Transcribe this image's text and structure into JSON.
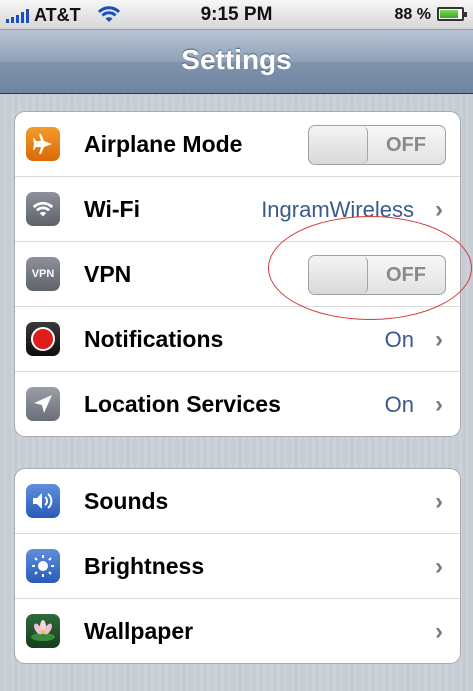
{
  "status_bar": {
    "carrier": "AT&T",
    "time": "9:15 PM",
    "battery": "88 %",
    "battery_level": 0.88
  },
  "nav": {
    "title": "Settings"
  },
  "group1": [
    {
      "label": "Airplane Mode",
      "icon": "airplane-icon",
      "control": "toggle",
      "state": "OFF"
    },
    {
      "label": "Wi-Fi",
      "icon": "wifi-icon",
      "value": "IngramWireless",
      "chevron": "›"
    },
    {
      "label": "VPN",
      "icon": "vpn-icon",
      "icon_text": "VPN",
      "control": "toggle",
      "state": "OFF"
    },
    {
      "label": "Notifications",
      "icon": "notifications-icon",
      "value": "On",
      "chevron": "›"
    },
    {
      "label": "Location Services",
      "icon": "location-arrow-icon",
      "value": "On",
      "chevron": "›"
    }
  ],
  "group2": [
    {
      "label": "Sounds",
      "icon": "speaker-icon",
      "chevron": "›"
    },
    {
      "label": "Brightness",
      "icon": "sun-icon",
      "chevron": "›"
    },
    {
      "label": "Wallpaper",
      "icon": "flower-icon",
      "chevron": "›"
    }
  ],
  "colors": {
    "background": "#c5ccd4",
    "nav_bar": "#8fa2b9",
    "value_text": "#3a5a8c",
    "annotation": "#d63a3a"
  }
}
